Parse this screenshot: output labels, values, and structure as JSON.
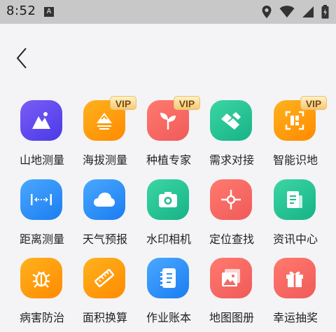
{
  "status_bar": {
    "time": "8:52",
    "notification_icon": "A",
    "icons": [
      "location-icon",
      "wifi-icon",
      "signal-icon",
      "battery-icon"
    ]
  },
  "header": {
    "back_icon": "chevron-left-icon"
  },
  "colors": {
    "background": "#f4f4f6",
    "vip_badge": "#f5c974"
  },
  "tools": [
    {
      "label": "山地测量",
      "icon": "mountain-icon",
      "color_from": "#7b5cf5",
      "color_to": "#4a3ae8",
      "vip": false
    },
    {
      "label": "海拔测量",
      "icon": "altitude-icon",
      "color_from": "#ffb21e",
      "color_to": "#ff8a00",
      "vip": true,
      "vip_label": "VIP"
    },
    {
      "label": "种植专家",
      "icon": "sprout-icon",
      "color_from": "#ff7a6e",
      "color_to": "#f05a5a",
      "vip": true,
      "vip_label": "VIP"
    },
    {
      "label": "需求对接",
      "icon": "handshake-icon",
      "color_from": "#3cd6a3",
      "color_to": "#16b387",
      "vip": false
    },
    {
      "label": "智能识地",
      "icon": "scan-icon",
      "color_from": "#ffb21e",
      "color_to": "#ff8a00",
      "vip": true,
      "vip_label": "VIP"
    },
    {
      "label": "距离测量",
      "icon": "distance-icon",
      "color_from": "#4aa8ff",
      "color_to": "#1a7df2",
      "vip": false
    },
    {
      "label": "天气预报",
      "icon": "cloud-icon",
      "color_from": "#4aa8ff",
      "color_to": "#1a7df2",
      "vip": false
    },
    {
      "label": "水印相机",
      "icon": "camera-icon",
      "color_from": "#3cd6a3",
      "color_to": "#16b387",
      "vip": false
    },
    {
      "label": "定位查找",
      "icon": "crosshair-icon",
      "color_from": "#ff7a6e",
      "color_to": "#f05a5a",
      "vip": false
    },
    {
      "label": "资讯中心",
      "icon": "news-icon",
      "color_from": "#3cd6a3",
      "color_to": "#16b387",
      "vip": false
    },
    {
      "label": "病害防治",
      "icon": "bug-icon",
      "color_from": "#ffb21e",
      "color_to": "#ff8a00",
      "vip": false
    },
    {
      "label": "面积换算",
      "icon": "ruler-icon",
      "color_from": "#ffb21e",
      "color_to": "#ff8a00",
      "vip": false
    },
    {
      "label": "作业账本",
      "icon": "notebook-icon",
      "color_from": "#4aa8ff",
      "color_to": "#1a7df2",
      "vip": false
    },
    {
      "label": "地图图册",
      "icon": "map-album-icon",
      "color_from": "#ff7a6e",
      "color_to": "#f05a5a",
      "vip": false
    },
    {
      "label": "幸运抽奖",
      "icon": "gift-icon",
      "color_from": "#ff7a6e",
      "color_to": "#f05a5a",
      "vip": false
    }
  ]
}
